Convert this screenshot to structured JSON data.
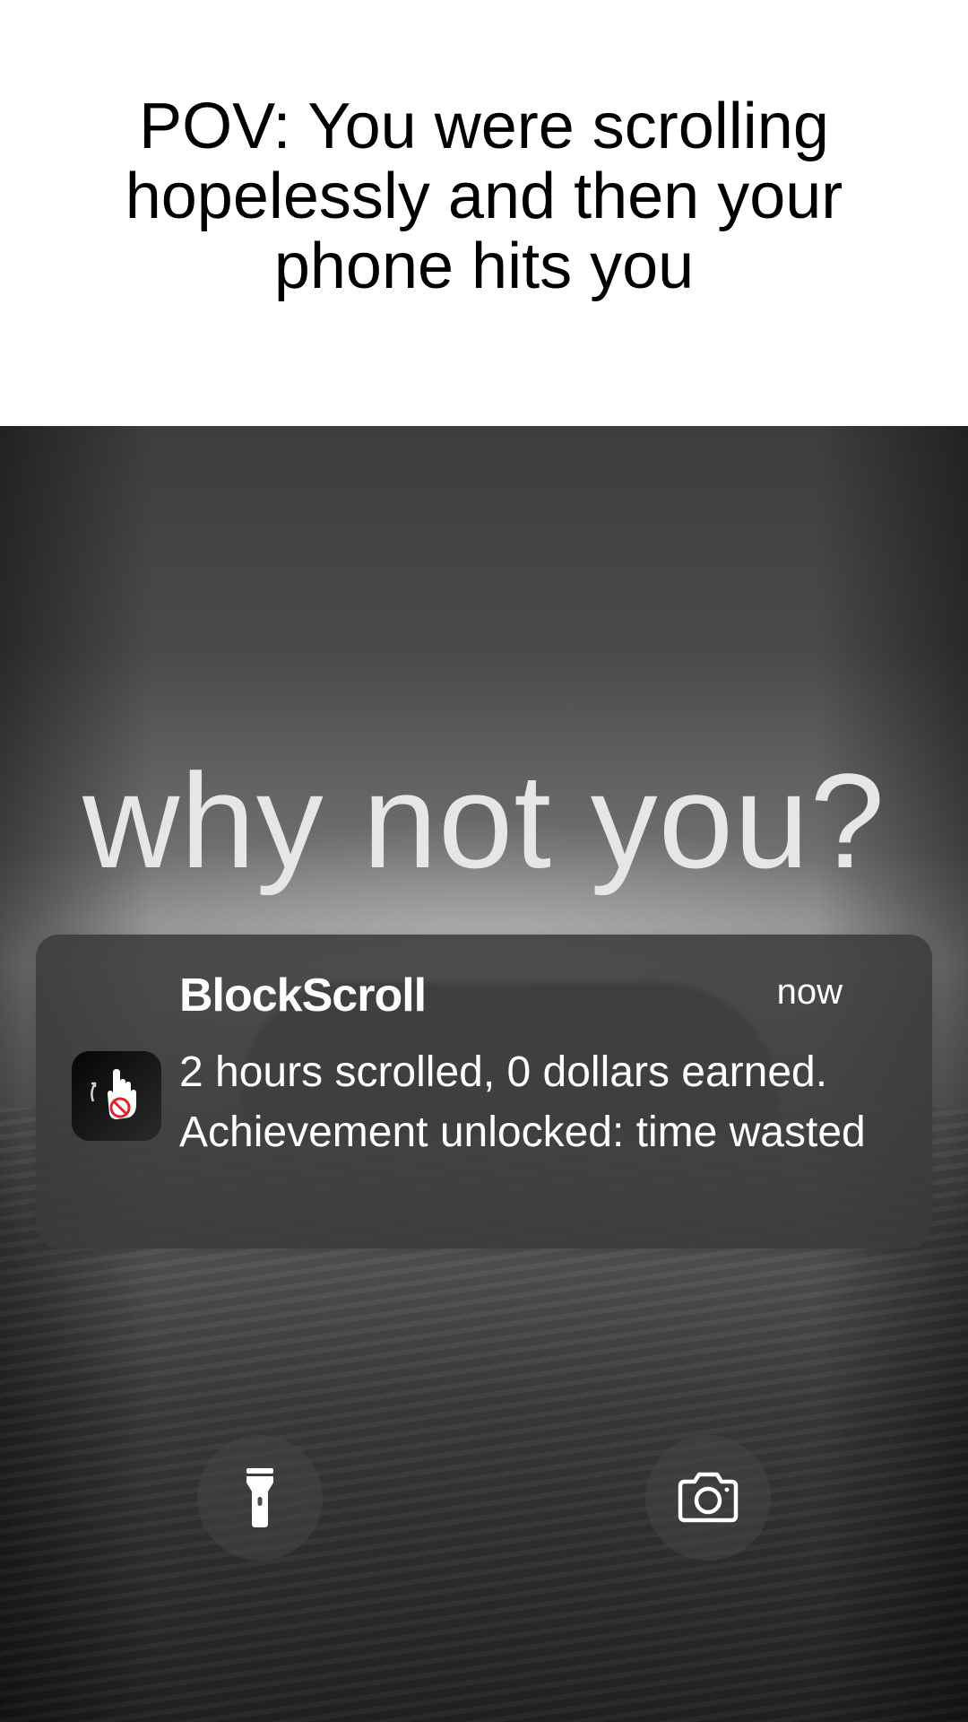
{
  "caption": {
    "text": "POV: You were scrolling hopelessly and then your phone hits you"
  },
  "lockscreen": {
    "headline": "why not you?",
    "notification": {
      "app_name": "BlockScroll",
      "time": "now",
      "message": "2 hours scrolled, 0 dollars earned. Achievement unlocked: time wasted",
      "icon": "hand-blocked-icon"
    },
    "quick_actions": [
      {
        "name": "flashlight",
        "icon": "flashlight-icon"
      },
      {
        "name": "camera",
        "icon": "camera-icon"
      }
    ]
  },
  "colors": {
    "notification_bg": "#3a3a3a",
    "headline_text": "#e6e6e6",
    "block_red": "#e0232a"
  }
}
